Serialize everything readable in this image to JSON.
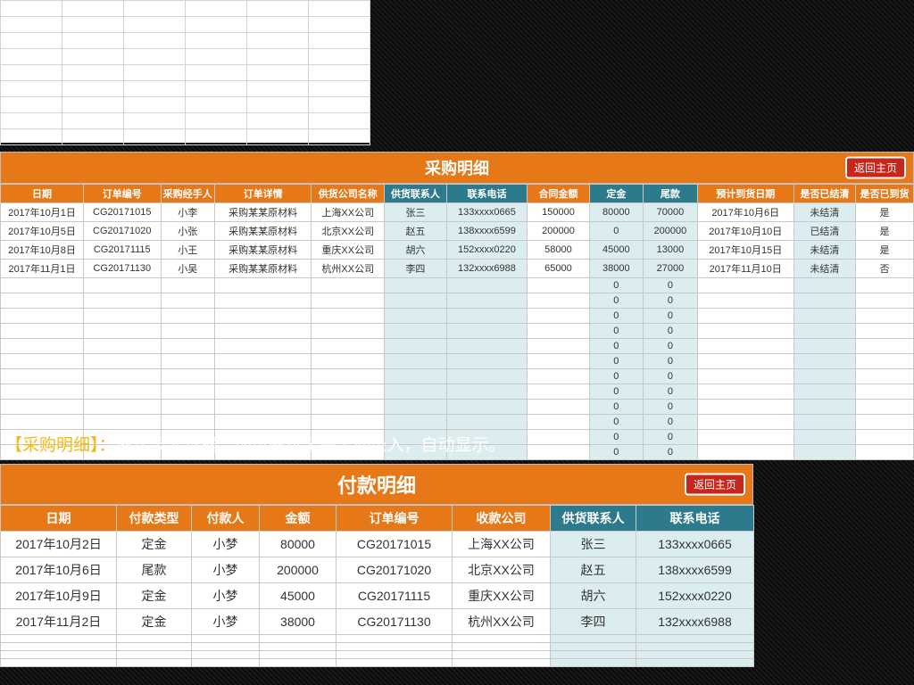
{
  "buttons": {
    "return_home": "返回主页"
  },
  "purchase": {
    "title": "采购明细",
    "headers": [
      "日期",
      "订单编号",
      "采购经手人",
      "订单详情",
      "供货公司名称",
      "供货联系人",
      "联系电话",
      "合同金额",
      "定金",
      "尾款",
      "预计到货日期",
      "是否已结清",
      "是否已到货"
    ],
    "teal_cols": [
      5,
      6,
      8,
      9
    ],
    "rows": [
      {
        "date": "2017年10月1日",
        "order": "CG20171015",
        "handler": "小李",
        "detail": "采购某某原材料",
        "company": "上海XX公司",
        "contact": "张三",
        "phone": "133xxxx0665",
        "amount": "150000",
        "deposit": "80000",
        "tail": "70000",
        "arrive": "2017年10月6日",
        "clear": "未结清",
        "recv": "是"
      },
      {
        "date": "2017年10月5日",
        "order": "CG20171020",
        "handler": "小张",
        "detail": "采购某某原材料",
        "company": "北京XX公司",
        "contact": "赵五",
        "phone": "138xxxx6599",
        "amount": "200000",
        "deposit": "0",
        "tail": "200000",
        "arrive": "2017年10月10日",
        "clear": "已结清",
        "recv": "是"
      },
      {
        "date": "2017年10月8日",
        "order": "CG20171115",
        "handler": "小王",
        "detail": "采购某某原材料",
        "company": "重庆XX公司",
        "contact": "胡六",
        "phone": "152xxxx0220",
        "amount": "58000",
        "deposit": "45000",
        "tail": "13000",
        "arrive": "2017年10月15日",
        "clear": "未结清",
        "recv": "是"
      },
      {
        "date": "2017年11月1日",
        "order": "CG20171130",
        "handler": "小吴",
        "detail": "采购某某原材料",
        "company": "杭州XX公司",
        "contact": "李四",
        "phone": "132xxxx6988",
        "amount": "65000",
        "deposit": "38000",
        "tail": "27000",
        "arrive": "2017年11月10日",
        "clear": "未结清",
        "recv": "否"
      }
    ],
    "empty_rows": 12,
    "zero_cols": [
      "deposit",
      "tail"
    ]
  },
  "caption": {
    "tag": "【采购明细】",
    "colon": "：",
    "text": "依次录入数据，绿色底纹无需手动录入，自动显示。"
  },
  "payment": {
    "title": "付款明细",
    "headers": [
      "日期",
      "付款类型",
      "付款人",
      "金额",
      "订单编号",
      "收款公司",
      "供货联系人",
      "联系电话"
    ],
    "teal_cols": [
      6,
      7
    ],
    "rows": [
      {
        "date": "2017年10月2日",
        "type": "定金",
        "payer": "小梦",
        "amount": "80000",
        "order": "CG20171015",
        "company": "上海XX公司",
        "contact": "张三",
        "phone": "133xxxx0665"
      },
      {
        "date": "2017年10月6日",
        "type": "尾款",
        "payer": "小梦",
        "amount": "200000",
        "order": "CG20171020",
        "company": "北京XX公司",
        "contact": "赵五",
        "phone": "138xxxx6599"
      },
      {
        "date": "2017年10月9日",
        "type": "定金",
        "payer": "小梦",
        "amount": "45000",
        "order": "CG20171115",
        "company": "重庆XX公司",
        "contact": "胡六",
        "phone": "152xxxx0220"
      },
      {
        "date": "2017年11月2日",
        "type": "定金",
        "payer": "小梦",
        "amount": "38000",
        "order": "CG20171130",
        "company": "杭州XX公司",
        "contact": "李四",
        "phone": "132xxxx6988"
      }
    ],
    "empty_rows": 4
  }
}
